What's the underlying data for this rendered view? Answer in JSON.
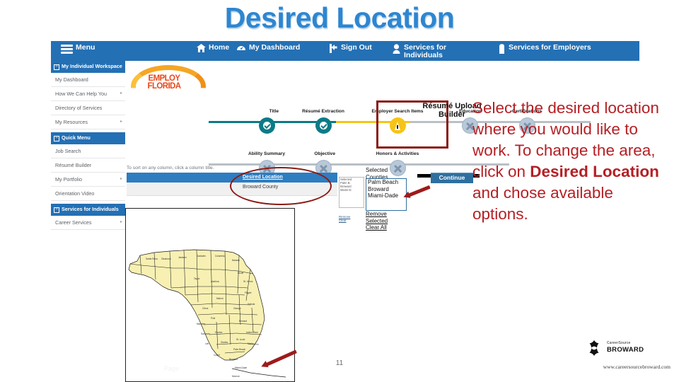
{
  "slide": {
    "title": "Desired Location",
    "page_number": "11",
    "footer_left": "Page",
    "footer_url": "www.careersourcebroward.com",
    "title_color": "#2E86D0"
  },
  "navbar": {
    "background": "#2470B4",
    "items": [
      {
        "label": "Menu",
        "icon": "hamburger-icon"
      },
      {
        "label": "Home",
        "icon": "home-icon"
      },
      {
        "label": "My Dashboard",
        "icon": "dashboard-icon"
      },
      {
        "label": "Sign Out",
        "icon": "sign-out-icon"
      },
      {
        "label": "Services for Individuals",
        "icon": "person-icon"
      },
      {
        "label": "Services for Employers",
        "icon": "building-icon"
      }
    ]
  },
  "sidebar": {
    "groups": [
      {
        "header": "My Individual Workspace",
        "items": [
          {
            "label": "My Dashboard",
            "caret": false
          },
          {
            "label": "How We Can Help You",
            "caret": true
          },
          {
            "label": "Directory of Services",
            "caret": false
          },
          {
            "label": "My Resources",
            "caret": true
          }
        ]
      },
      {
        "header": "Quick Menu",
        "items": [
          {
            "label": "Job Search",
            "caret": false
          },
          {
            "label": "Résumé Builder",
            "caret": false
          },
          {
            "label": "My Portfolio",
            "caret": true
          },
          {
            "label": "Orientation Video",
            "caret": false
          }
        ]
      },
      {
        "header": "Services for Individuals",
        "items": [
          {
            "label": "Career Services",
            "caret": true
          }
        ]
      }
    ]
  },
  "logo": {
    "line1": "EMPLOY",
    "line2": "FLORIDA"
  },
  "progress": {
    "heading": "Résumé Upload Builder",
    "top_steps": [
      {
        "label": "Title",
        "state": "done"
      },
      {
        "label": "Résumé Extraction",
        "state": "done"
      },
      {
        "label": "Employer Search Items",
        "state": "warn"
      },
      {
        "label": "Education",
        "state": "todo"
      },
      {
        "label": "Certifications",
        "state": "todo"
      }
    ],
    "bottom_steps": [
      {
        "label": "Ability Summary",
        "state": "todo"
      },
      {
        "label": "Objective",
        "state": "todo"
      },
      {
        "label": "Honors & Activities",
        "state": "todo"
      }
    ]
  },
  "table": {
    "sort_hint": "To sort on any column, click a column title.",
    "columns": [
      "Desired Location"
    ],
    "rows": [
      [
        "Broward County"
      ]
    ]
  },
  "counties_panel": {
    "label": "Selected Counties",
    "selected": [
      "Palm Beach",
      "Broward",
      "Miami-Dade"
    ],
    "links": [
      "Remove Selected",
      "Clear All"
    ],
    "ghost_links": [
      "Remove",
      "Clear"
    ],
    "continue_label": "Continue"
  },
  "map": {
    "name": "florida-county-map",
    "highlight_county": "Broward",
    "fill_color": "#F7F0B2"
  },
  "instruction": {
    "part1": "Select the desired location where you would like to work. To change the area, click on ",
    "bold": "Desired Location",
    "part2": " and chose available options."
  },
  "brand": {
    "line1": "CareerSource",
    "line2": "BROWARD"
  }
}
